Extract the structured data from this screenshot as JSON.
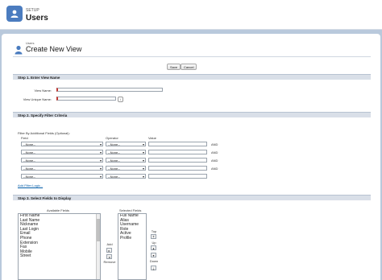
{
  "setup_header": {
    "section": "SETUP",
    "title": "Users"
  },
  "page": {
    "breadcrumb": "Users",
    "title": "Create New View"
  },
  "actions": {
    "save": "Save",
    "cancel": "Cancel"
  },
  "step1": {
    "title": "Step 1. Enter View Name",
    "view_name_label": "View Name:",
    "view_unique_name_label": "View Unique Name:",
    "help": "i"
  },
  "step2": {
    "title": "Step 2. Specify Filter Criteria",
    "subtitle": "Filter By Additional Fields (Optional):",
    "col_field": "Field",
    "col_operator": "Operator",
    "col_value": "Value",
    "rows": [
      {
        "field": "--None--",
        "operator": "--None--",
        "conj": "AND"
      },
      {
        "field": "--None--",
        "operator": "--None--",
        "conj": "AND"
      },
      {
        "field": "--None--",
        "operator": "--None--",
        "conj": "AND"
      },
      {
        "field": "--None--",
        "operator": "--None--",
        "conj": "AND"
      },
      {
        "field": "--None--",
        "operator": "--None--",
        "conj": ""
      }
    ],
    "add_filter_logic": "Add Filter Logic..."
  },
  "step3": {
    "title": "Step 3. Select Fields to Display",
    "available_label": "Available Fields",
    "selected_label": "Selected Fields",
    "available": [
      "First Name",
      "Last Name",
      "Nickname",
      "Last Login",
      "Email",
      "Phone",
      "Extension",
      "Fax",
      "Mobile",
      "Street"
    ],
    "selected": [
      "Full Name",
      "Alias",
      "Username",
      "Role",
      "Active",
      "Profile"
    ],
    "add_label": "Add",
    "remove_label": "Remove",
    "top_label": "Top",
    "up_label": "Up",
    "down_label": "Down"
  }
}
